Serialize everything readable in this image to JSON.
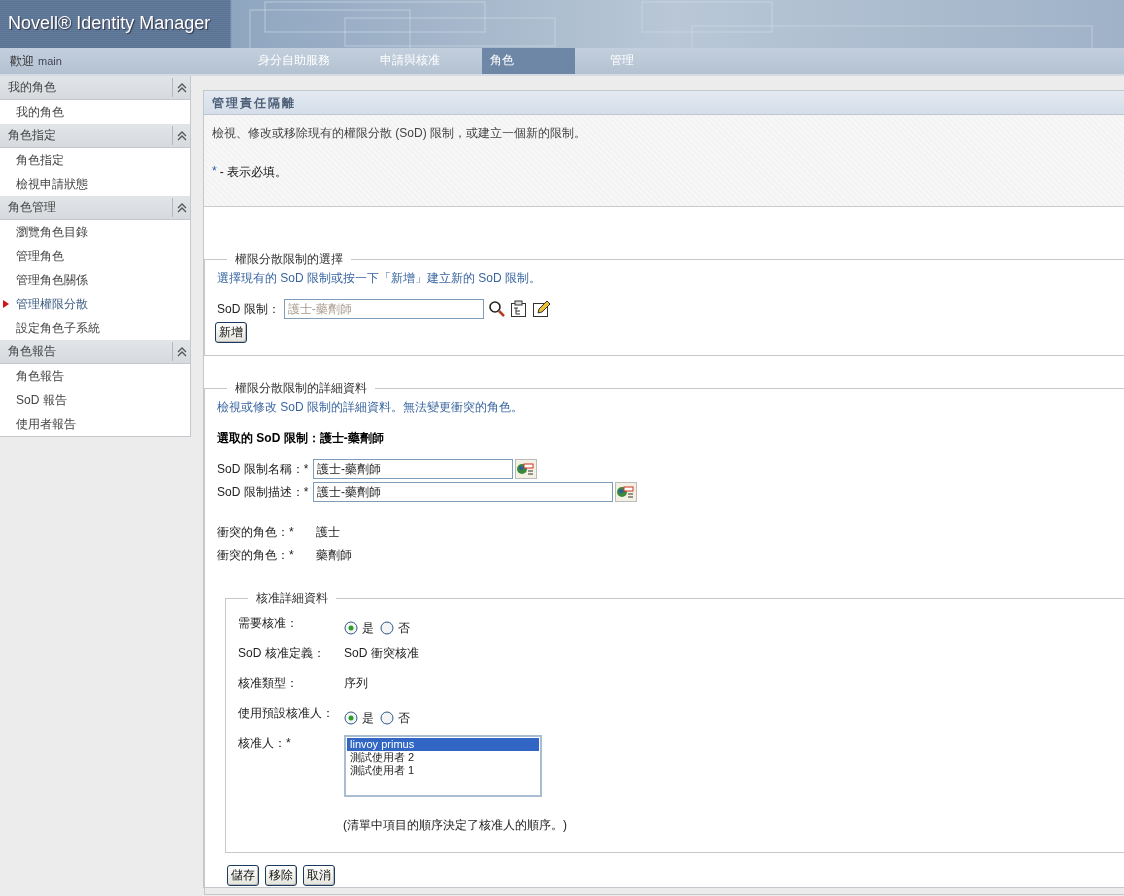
{
  "header": {
    "logo": "Novell® Identity Manager",
    "welcome": "歡迎",
    "user": "main",
    "tabs": [
      {
        "label": "身分自助服務",
        "selected": false
      },
      {
        "label": "申請與核准",
        "selected": false
      },
      {
        "label": "角色",
        "selected": true
      },
      {
        "label": "管理",
        "selected": false
      }
    ]
  },
  "sidebar": {
    "sections": [
      {
        "title": "我的角色",
        "expanded": true,
        "items": [
          {
            "label": "我的角色",
            "selected": false
          }
        ]
      },
      {
        "title": "角色指定",
        "expanded": true,
        "items": [
          {
            "label": "角色指定",
            "selected": false
          },
          {
            "label": "檢視申請狀態",
            "selected": false
          }
        ]
      },
      {
        "title": "角色管理",
        "expanded": true,
        "items": [
          {
            "label": "瀏覽角色目錄",
            "selected": false
          },
          {
            "label": "管理角色",
            "selected": false
          },
          {
            "label": "管理角色關係",
            "selected": false
          },
          {
            "label": "管理權限分散",
            "selected": true
          },
          {
            "label": "設定角色子系統",
            "selected": false
          }
        ]
      },
      {
        "title": "角色報告",
        "expanded": true,
        "items": [
          {
            "label": "角色報告",
            "selected": false
          },
          {
            "label": "SoD 報告",
            "selected": false
          },
          {
            "label": "使用者報告",
            "selected": false
          }
        ]
      }
    ]
  },
  "page": {
    "title": "管理責任隔離",
    "intro": "檢視、修改或移除現有的權限分散 (SoD) 限制，或建立一個新的限制。",
    "required_mark": "*",
    "required_text": "- 表示必填。"
  },
  "selection": {
    "legend": "權限分散限制的選擇",
    "hint": "選擇現有的 SoD 限制或按一下「新增」建立新的 SoD 限制。",
    "field_label": "SoD 限制：",
    "placeholder": "護士-藥劑師",
    "new_button": "新增"
  },
  "details": {
    "legend": "權限分散限制的詳細資料",
    "hint": "檢視或修改 SoD 限制的詳細資料。無法變更衝突的角色。",
    "selected_heading": "選取的 SoD 限制：護士-藥劑師",
    "fields": [
      {
        "label": "SoD 限制名稱：*",
        "value": "護士-藥劑師"
      },
      {
        "label": "SoD 限制描述：*",
        "value": "護士-藥劑師"
      }
    ],
    "conflicting_roles": [
      {
        "label": "衝突的角色：*",
        "value": "護士"
      },
      {
        "label": "衝突的角色：*",
        "value": "藥劑師"
      }
    ]
  },
  "approval": {
    "legend": "核准詳細資料",
    "rows": [
      {
        "kind": "radio",
        "label": "需要核准：",
        "options": [
          {
            "label": "是",
            "selected": true
          },
          {
            "label": "否",
            "selected": false
          }
        ]
      },
      {
        "kind": "text",
        "label": "SoD 核准定義：",
        "value": "SoD 衝突核准"
      },
      {
        "kind": "text",
        "label": "核准類型：",
        "value": "序列"
      },
      {
        "kind": "radio",
        "label": "使用預設核准人：",
        "options": [
          {
            "label": "是",
            "selected": true
          },
          {
            "label": "否",
            "selected": false
          }
        ]
      },
      {
        "kind": "list",
        "label": "核准人：*",
        "items": [
          {
            "label": "linvoy primus",
            "selected": true
          },
          {
            "label": "測試使用者 2",
            "selected": false
          },
          {
            "label": "測試使用者 1",
            "selected": false
          }
        ],
        "note": "(清單中項目的順序決定了核准人的順序。)"
      }
    ]
  },
  "buttons": [
    "儲存",
    "移除",
    "取消"
  ]
}
